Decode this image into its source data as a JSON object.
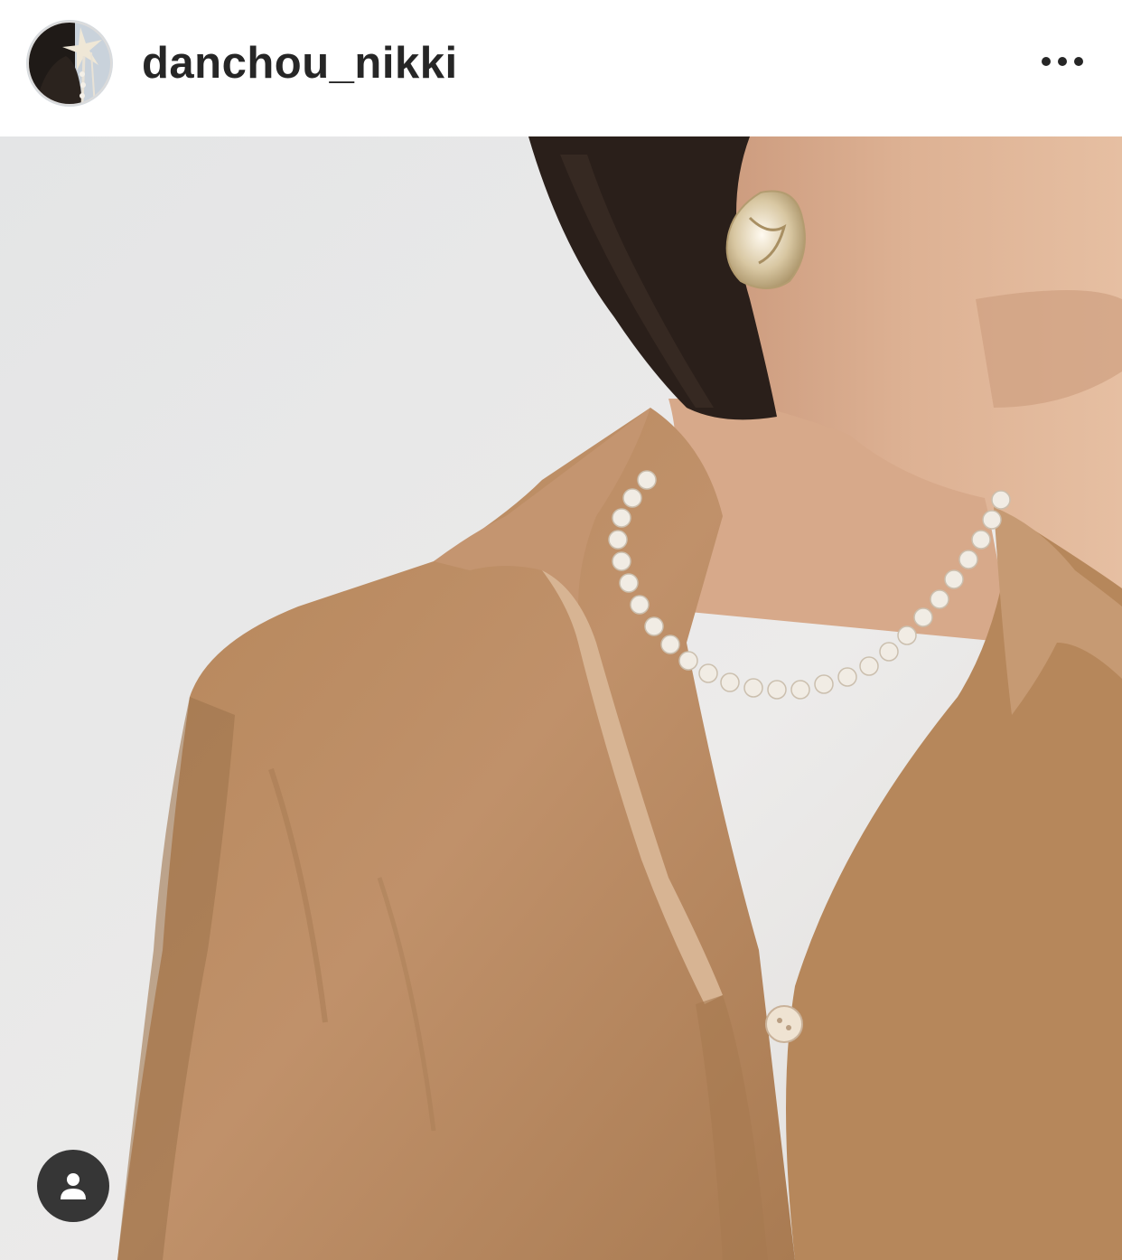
{
  "post": {
    "username": "danchou_nikki",
    "avatar_icon": "profile-avatar",
    "more_icon": "more-options-icon",
    "tag_icon": "user-tag-icon"
  },
  "colors": {
    "text_primary": "#262626",
    "header_bg": "#ffffff",
    "wall": "#e9e8e6",
    "shirt": "#b98a5e",
    "skin": "#d9ab8c",
    "hair": "#2a1f1a",
    "pearl": "#f1ece4",
    "earring": "#d9c8a4",
    "tag_bg": "#262626"
  }
}
